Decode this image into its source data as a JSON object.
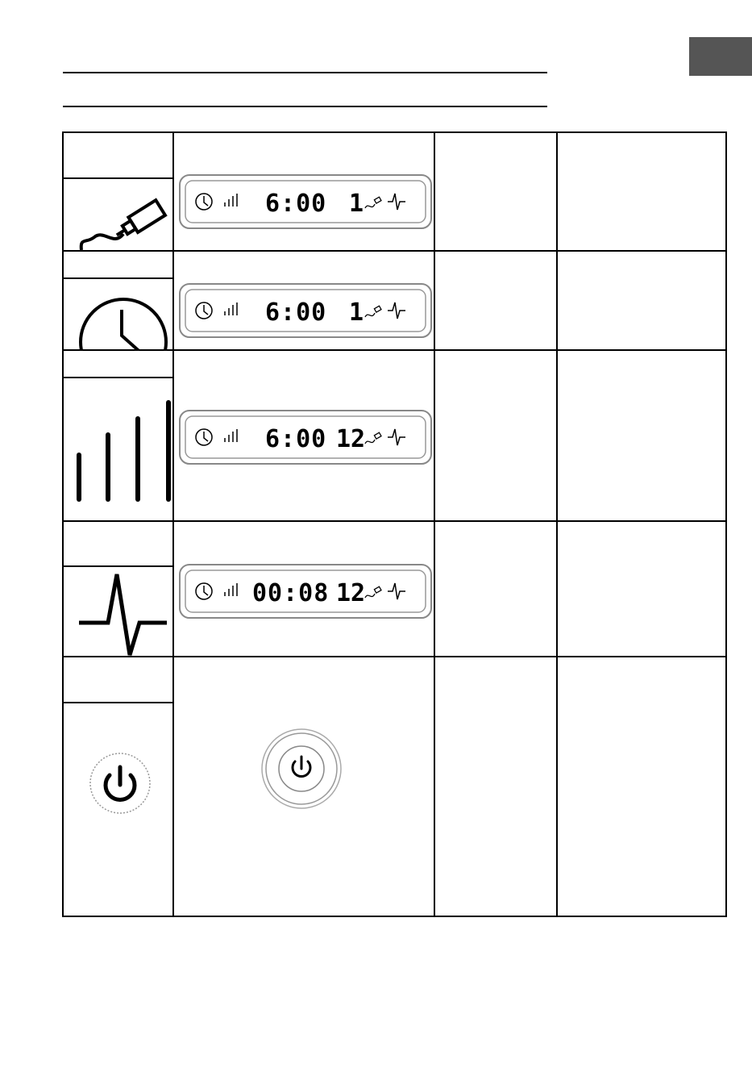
{
  "page": {
    "tab_color": "#555555"
  },
  "rows": [
    {
      "icon": "pen-icon",
      "display": {
        "time": "6:00",
        "level": "1"
      }
    },
    {
      "icon": "clock-icon",
      "display": {
        "time": "6:00",
        "level": "1"
      }
    },
    {
      "icon": "signal-bars-icon",
      "display": {
        "time": "6:00",
        "level": "12"
      }
    },
    {
      "icon": "pulse-wave-icon",
      "display": {
        "time": "00:08",
        "level": "12"
      }
    },
    {
      "icon": "power-button-icon",
      "button": "power-button-icon"
    }
  ]
}
